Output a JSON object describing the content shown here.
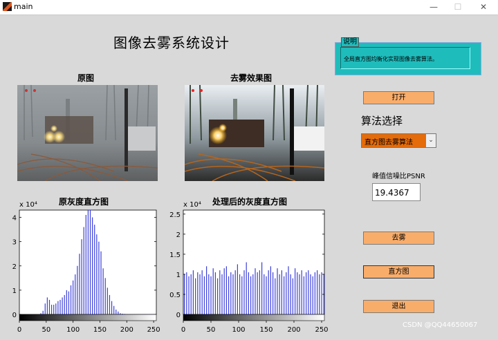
{
  "window": {
    "title": "main",
    "minimize": "—",
    "maximize": "☐",
    "close": "✕"
  },
  "main_title": "图像去雾系统设计",
  "axes": {
    "original_title": "原图",
    "dehazed_title": "去雾效果图",
    "hist_original_title": "原灰度直方图",
    "hist_processed_title": "处理后的灰度直方图"
  },
  "info_panel": {
    "label": "说明",
    "text": "全局直方图均衡化实现图像去雾算法。"
  },
  "buttons": {
    "open": "打开",
    "dehaze": "去雾",
    "histogram": "直方图",
    "exit": "退出"
  },
  "algorithm": {
    "label": "算法选择",
    "selected": "直方图去雾算法"
  },
  "psnr": {
    "label": "峰值信噪比PSNR",
    "value": "19.4367"
  },
  "watermark": "CSDN @QQ44650067",
  "colors": {
    "orange_button": "#f9ad6b",
    "select_bg": "#e46c0a",
    "panel": "#1fbcbc",
    "bar": "#3b3fd8"
  },
  "chart_data": [
    {
      "type": "bar",
      "title": "原灰度直方图",
      "multiplier": "x 10⁴",
      "xlim": [
        0,
        255
      ],
      "ylim": [
        0,
        4.3
      ],
      "xticks": [
        0,
        50,
        100,
        150,
        200,
        250
      ],
      "yticks": [
        0,
        1,
        2,
        3,
        4
      ],
      "x": [
        40,
        44,
        48,
        52,
        56,
        60,
        64,
        68,
        72,
        76,
        80,
        84,
        88,
        92,
        96,
        100,
        104,
        108,
        112,
        116,
        120,
        124,
        128,
        132,
        136,
        140,
        144,
        148,
        152,
        156,
        160,
        164,
        168,
        172,
        176,
        180,
        184,
        188,
        192,
        196,
        200,
        204,
        208,
        212,
        216,
        220,
        224,
        228,
        232,
        236,
        240,
        244,
        248,
        252
      ],
      "values": [
        0.05,
        0.15,
        0.45,
        0.7,
        0.6,
        0.4,
        0.4,
        0.45,
        0.55,
        0.6,
        0.7,
        0.8,
        1.0,
        0.95,
        1.2,
        1.4,
        1.65,
        2.0,
        2.5,
        3.1,
        3.6,
        4.1,
        4.3,
        4.3,
        4.0,
        3.7,
        3.3,
        3.0,
        2.6,
        1.9,
        1.5,
        1.1,
        0.8,
        0.55,
        0.35,
        0.2,
        0.12,
        0.05,
        0.03,
        0.02,
        0.01,
        0.01,
        0.01,
        0.01,
        0.01,
        0.01,
        0.01,
        0.01,
        0.01,
        0.01,
        0.01,
        0.01,
        0.01,
        0.01
      ]
    },
    {
      "type": "bar",
      "title": "处理后的灰度直方图",
      "multiplier": "x 10⁴",
      "xlim": [
        0,
        255
      ],
      "ylim": [
        0,
        2.6
      ],
      "xticks": [
        0,
        50,
        100,
        150,
        200,
        250
      ],
      "yticks": [
        0,
        0.5,
        1,
        1.5,
        2,
        2.5
      ],
      "x": [
        2,
        6,
        10,
        14,
        18,
        22,
        26,
        30,
        34,
        38,
        42,
        46,
        50,
        54,
        58,
        62,
        66,
        70,
        74,
        78,
        82,
        86,
        90,
        94,
        98,
        102,
        106,
        110,
        114,
        118,
        122,
        126,
        130,
        134,
        138,
        142,
        146,
        150,
        154,
        158,
        162,
        166,
        170,
        174,
        178,
        182,
        186,
        190,
        194,
        198,
        202,
        206,
        210,
        214,
        218,
        222,
        226,
        230,
        234,
        238,
        242,
        246,
        250,
        254
      ],
      "values": [
        1.0,
        1.05,
        0.95,
        1.0,
        1.1,
        0.9,
        1.05,
        1.0,
        1.1,
        0.95,
        1.2,
        1.0,
        0.95,
        1.15,
        1.05,
        0.9,
        1.1,
        1.0,
        1.15,
        1.2,
        0.95,
        1.05,
        1.0,
        1.1,
        1.25,
        1.0,
        0.95,
        1.1,
        1.3,
        1.05,
        0.95,
        1.0,
        1.15,
        1.05,
        1.1,
        1.3,
        1.0,
        0.95,
        1.1,
        1.2,
        1.05,
        0.9,
        1.15,
        1.0,
        1.1,
        0.95,
        1.05,
        1.2,
        1.0,
        0.9,
        1.15,
        1.05,
        1.0,
        1.1,
        0.95,
        1.05,
        1.1,
        1.0,
        0.95,
        1.05,
        1.1,
        1.0,
        1.05,
        1.0
      ]
    }
  ]
}
